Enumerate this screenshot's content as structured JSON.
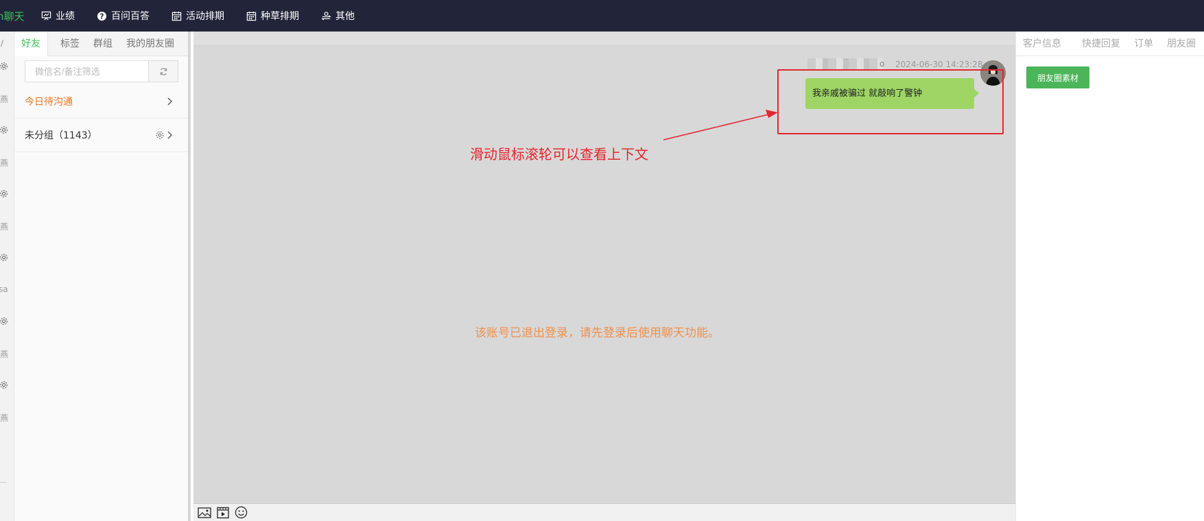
{
  "brand": "h聊天",
  "nav": [
    {
      "label": "业绩",
      "icon": "presentation-icon"
    },
    {
      "label": "百问百答",
      "icon": "help-circle-icon"
    },
    {
      "label": "活动排期",
      "icon": "calendar-icon"
    },
    {
      "label": "种草排期",
      "icon": "calendar-icon"
    },
    {
      "label": "其他",
      "icon": "settings-swap-icon"
    }
  ],
  "rail": {
    "top_mark": "/",
    "entries": [
      "燕",
      "燕",
      "燕",
      "sa",
      "燕",
      "燕"
    ]
  },
  "friends": {
    "tabs": [
      "好友",
      "标签",
      "群组",
      "我的朋友圈"
    ],
    "active_tab": "好友",
    "search": {
      "placeholder": "微信名/备注筛选",
      "value": ""
    },
    "groups": [
      {
        "label": "今日待沟通"
      },
      {
        "label": "未分组（1143）"
      }
    ]
  },
  "chat": {
    "sender_tail": "o",
    "timestamp": "2024-06-30 14:23:28",
    "message": "我亲戚被骗过 就敲响了警钟",
    "annotation": "滑动鼠标滚轮可以查看上下文",
    "logout_notice": "该账号已退出登录，请先登录后使用聊天功能。",
    "toolbar": [
      "image-icon",
      "video-icon",
      "emoji-icon"
    ]
  },
  "right": {
    "tabs": [
      "客户信息",
      "快捷回复",
      "订单",
      "朋友圈"
    ],
    "moments_button": "朋友圈素材"
  },
  "colors": {
    "topbar": "#22253a",
    "accent_green": "#3fbf5a",
    "bubble": "#9ed564",
    "annotation_red": "#e3272d",
    "notice_orange": "#f0904b",
    "today_orange": "#e87722",
    "chat_bg": "#d8d8d8"
  }
}
